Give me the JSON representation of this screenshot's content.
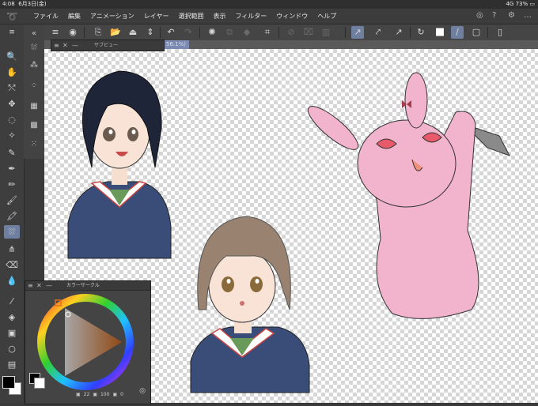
{
  "status": {
    "time": "4:08",
    "date": "6月3日(金)",
    "network": "4G",
    "battery": "73%"
  },
  "menu": {
    "items": [
      "ファイル",
      "編集",
      "アニメーション",
      "レイヤー",
      "選択範囲",
      "表示",
      "フィルター",
      "ウィンドウ",
      "ヘルプ"
    ]
  },
  "subview": {
    "title": "サブビュー"
  },
  "canvas": {
    "zoom_label": "56.1%)"
  },
  "color_panel": {
    "title": "カラーサークル",
    "info": [
      "22",
      "100",
      "0"
    ]
  },
  "colors": {
    "accent": "#6f7fa0",
    "fg": "#000000",
    "bg": "#ffffff",
    "hue_marker": "#e07020"
  }
}
